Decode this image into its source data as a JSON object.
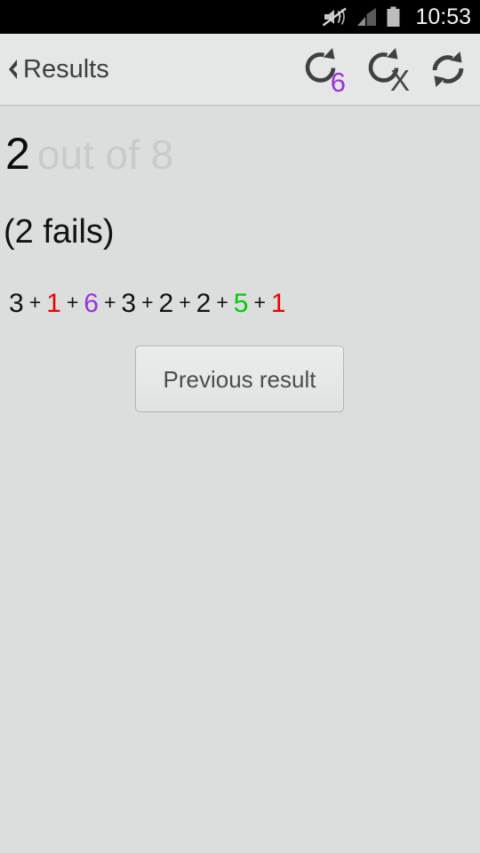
{
  "status_bar": {
    "time": "10:53",
    "icons": [
      {
        "name": "mute-vibrate-icon",
        "label": "sound-off"
      },
      {
        "name": "signal-bars-icon",
        "label": "signal"
      },
      {
        "name": "battery-icon",
        "label": "battery"
      }
    ]
  },
  "action_bar": {
    "back_label": "Results",
    "back_icon": "back-chevron-icon",
    "actions": [
      {
        "name": "repeat-count-button",
        "icon": "circular-arrow-icon",
        "badge": "6",
        "badge_color": "#9b31e0"
      },
      {
        "name": "repeat-failed-button",
        "icon": "circular-arrow-icon",
        "badge": "X",
        "badge_color": "#444746"
      },
      {
        "name": "restart-button",
        "icon": "sync-refresh-icon",
        "badge": "",
        "badge_color": ""
      }
    ]
  },
  "content": {
    "score_value": "2",
    "score_rest": "out of 8",
    "fails_text": "(2 fails)",
    "formula": {
      "operator": "+",
      "terms": [
        {
          "value": "3",
          "color": "#111312"
        },
        {
          "value": "1",
          "color": "#ee0000"
        },
        {
          "value": "6",
          "color": "#9b31e0"
        },
        {
          "value": "3",
          "color": "#111312"
        },
        {
          "value": "2",
          "color": "#111312"
        },
        {
          "value": "2",
          "color": "#111312"
        },
        {
          "value": "5",
          "color": "#00cc00"
        },
        {
          "value": "1",
          "color": "#ee0000"
        }
      ]
    },
    "previous_button_label": "Previous result"
  },
  "colors": {
    "screen_bg": "#dcdedd",
    "action_bar_bg": "#e4e7e6",
    "status_bar_bg": "#000000",
    "muted_text": "#c9cbca"
  }
}
